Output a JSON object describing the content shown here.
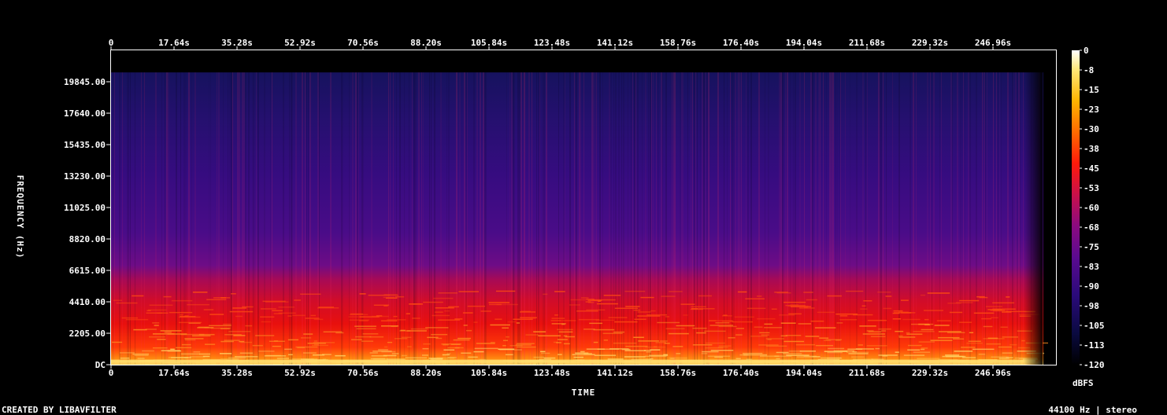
{
  "chart_data": {
    "type": "heatmap",
    "xlabel": "TIME",
    "ylabel": "FREQUENCY (Hz)",
    "x_tick_labels": [
      "0",
      "17.64s",
      "35.28s",
      "52.92s",
      "70.56s",
      "88.20s",
      "105.84s",
      "123.48s",
      "141.12s",
      "158.76s",
      "176.40s",
      "194.04s",
      "211.68s",
      "229.32s",
      "246.96s"
    ],
    "x_ticks_seconds": [
      0,
      17.64,
      35.28,
      52.92,
      70.56,
      88.2,
      105.84,
      123.48,
      141.12,
      158.76,
      176.4,
      194.04,
      211.68,
      229.32,
      246.96
    ],
    "y_tick_labels": [
      "DC",
      "2205.00",
      "4410.00",
      "6615.00",
      "8820.00",
      "11025.00",
      "13230.00",
      "15435.00",
      "17640.00",
      "19845.00"
    ],
    "y_ticks_hz": [
      0,
      2205,
      4410,
      6615,
      8820,
      11025,
      13230,
      15435,
      17640,
      19845
    ],
    "xlim": [
      0,
      264.6
    ],
    "ylim": [
      0,
      22050
    ],
    "signal_end_seconds": 261,
    "signal_top_hz": 20500,
    "colorbar": {
      "unit": "dBFS",
      "labels": [
        "0",
        "-8",
        "-15",
        "-23",
        "-30",
        "-38",
        "-45",
        "-53",
        "-60",
        "-68",
        "-75",
        "-83",
        "-90",
        "-98",
        "-105",
        "-113",
        "-120"
      ],
      "range": [
        -120,
        0
      ],
      "colors": [
        "#000000",
        "#0a0a40",
        "#2a0a7a",
        "#5a0a90",
        "#8a0a80",
        "#c8104a",
        "#ff1a0a",
        "#ff6a00",
        "#ffb400",
        "#ffe87a",
        "#ffffff"
      ]
    }
  },
  "footer": {
    "credit": "CREATED BY LIBAVFILTER",
    "info": "44100 Hz | stereo"
  }
}
